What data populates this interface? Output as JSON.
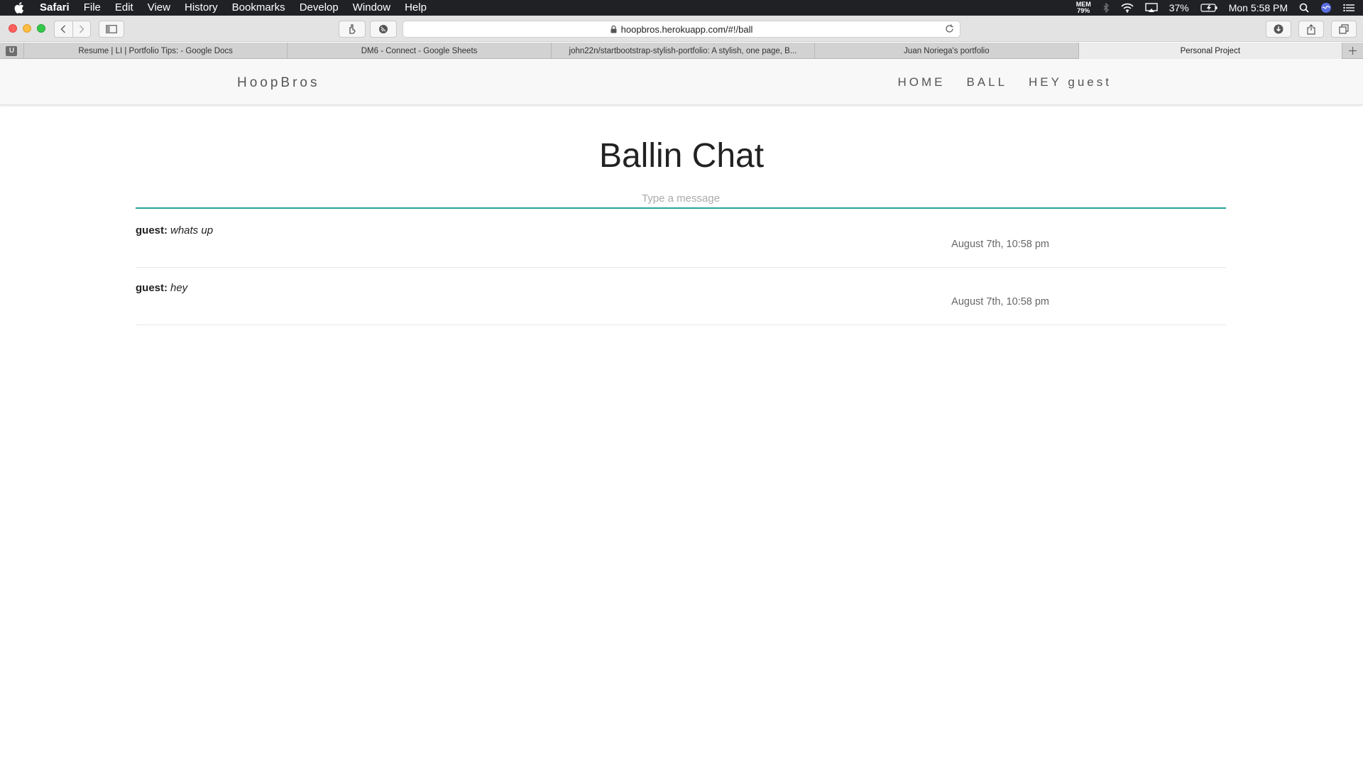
{
  "menubar": {
    "app_name": "Safari",
    "items": [
      "File",
      "Edit",
      "View",
      "History",
      "Bookmarks",
      "Develop",
      "Window",
      "Help"
    ],
    "mem_label": "MEM",
    "mem_value": "79%",
    "battery": "37%",
    "clock": "Mon 5:58 PM"
  },
  "browser": {
    "url": "hoopbros.herokuapp.com/#!/ball",
    "tabs": [
      {
        "label": "Resume | LI | Portfolio Tips: - Google Docs",
        "active": false
      },
      {
        "label": "DM6 - Connect - Google Sheets",
        "active": false
      },
      {
        "label": "john22n/startbootstrap-stylish-portfolio: A stylish, one page, B...",
        "active": false
      },
      {
        "label": "Juan Noriega's portfolio",
        "active": false
      },
      {
        "label": "Personal Project",
        "active": true
      }
    ],
    "extension_badge": "U"
  },
  "site": {
    "brand": "HoopBros",
    "nav": [
      "HOME",
      "BALL",
      "HEY guest"
    ]
  },
  "chat": {
    "title": "Ballin Chat",
    "input_placeholder": "Type a message",
    "messages": [
      {
        "author": "guest:",
        "text": "whats up",
        "time": "August 7th, 10:58 pm"
      },
      {
        "author": "guest:",
        "text": "hey",
        "time": "August 7th, 10:58 pm"
      }
    ]
  },
  "colors": {
    "accent": "#26a69a",
    "menubar": "#1f2125",
    "navbar": "#f8f8f8"
  }
}
